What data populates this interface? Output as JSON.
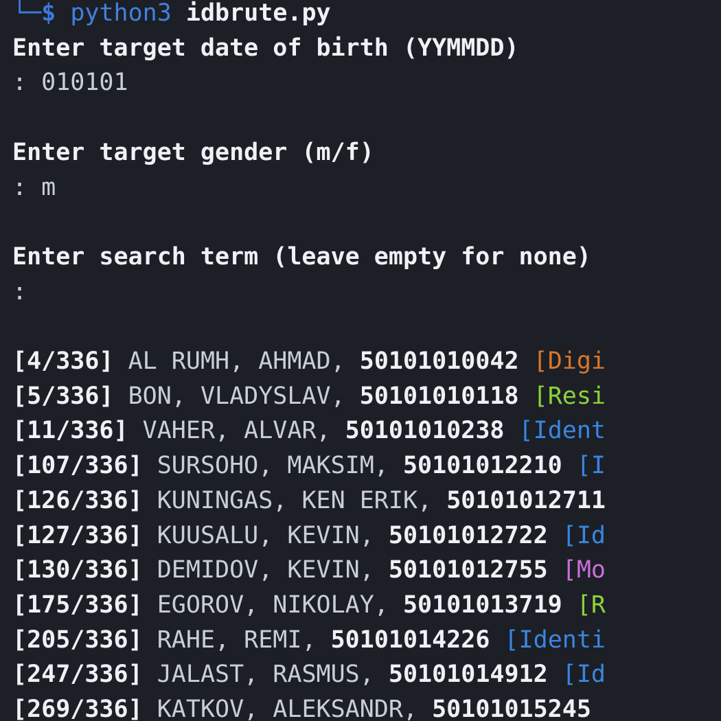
{
  "prompt": {
    "corner": "└─",
    "dollar": "$",
    "command": "python3",
    "script": "idbrute.py"
  },
  "prompts": [
    {
      "question": "Enter target date of birth (YYMMDD)",
      "answer": ": 010101"
    },
    {
      "question": "Enter target gender (m/f)",
      "answer": ": m"
    },
    {
      "question": "Enter search term (leave empty for none)",
      "answer": ":"
    }
  ],
  "results": [
    {
      "counter": "[4/336]",
      "name": "AL RUMH, AHMAD,",
      "code": "50101010042",
      "tag": "[Digi",
      "tag_color": "#d9772b"
    },
    {
      "counter": "[5/336]",
      "name": "BON, VLADYSLAV,",
      "code": "50101010118",
      "tag": "[Resi",
      "tag_color": "#8ed23a"
    },
    {
      "counter": "[11/336]",
      "name": "VAHER, ALVAR,",
      "code": "50101010238",
      "tag": "[Ident",
      "tag_color": "#3a86e0"
    },
    {
      "counter": "[107/336]",
      "name": "SURSOHO, MAKSIM,",
      "code": "50101012210",
      "tag": "[I",
      "tag_color": "#3a86e0"
    },
    {
      "counter": "[126/336]",
      "name": "KUNINGAS, KEN ERIK,",
      "code": "50101012711",
      "tag": "",
      "tag_color": "#3a86e0"
    },
    {
      "counter": "[127/336]",
      "name": "KUUSALU, KEVIN,",
      "code": "50101012722",
      "tag": "[Id",
      "tag_color": "#3a86e0"
    },
    {
      "counter": "[130/336]",
      "name": "DEMIDOV, KEVIN,",
      "code": "50101012755",
      "tag": "[Mo",
      "tag_color": "#c86fd8"
    },
    {
      "counter": "[175/336]",
      "name": "EGOROV, NIKOLAY,",
      "code": "50101013719",
      "tag": "[R",
      "tag_color": "#8ed23a"
    },
    {
      "counter": "[205/336]",
      "name": "RAHE, REMI,",
      "code": "50101014226",
      "tag": "[Identi",
      "tag_color": "#3a86e0"
    },
    {
      "counter": "[247/336]",
      "name": "JALAST, RASMUS,",
      "code": "50101014912",
      "tag": "[Id",
      "tag_color": "#3a86e0"
    },
    {
      "counter": "[269/336]",
      "name": "KATKOV, ALEKSANDR,",
      "code": "50101015245",
      "tag": "",
      "tag_color": "#3a86e0"
    }
  ]
}
